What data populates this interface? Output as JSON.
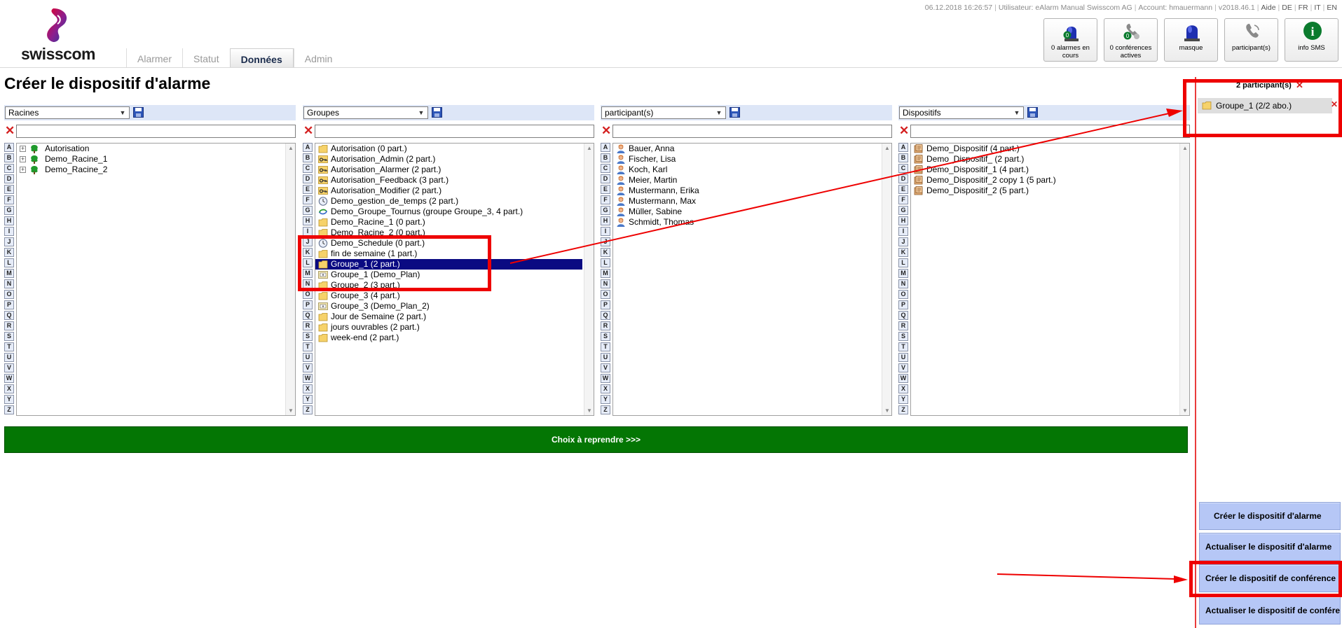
{
  "header": {
    "brand": "swisscom",
    "info": {
      "datetime": "06.12.2018 16:26:57",
      "user": "Utilisateur: eAlarm Manual Swisscom AG",
      "account": "Account: hmauermann",
      "version": "v2018.46.1",
      "help": "Aide",
      "languages": [
        "DE",
        "FR",
        "IT",
        "EN"
      ]
    },
    "tabs": [
      "Alarmer",
      "Statut",
      "Données",
      "Admin"
    ],
    "active_tab": "Données",
    "status_buttons": [
      {
        "label": "0 alarmes en cours",
        "icon": "alarm-light-icon",
        "badge": "0"
      },
      {
        "label": "0 conférences actives",
        "icon": "conference-phone-icon",
        "badge": "0"
      },
      {
        "label": "masque",
        "icon": "blue-light-icon"
      },
      {
        "label": "participant(s)",
        "icon": "phone-icon"
      },
      {
        "label": "info SMS",
        "icon": "info-icon",
        "badge": "i"
      }
    ]
  },
  "page": {
    "title": "Créer le dispositif d'alarme"
  },
  "columns": [
    {
      "select_value": "Racines",
      "filter_value": "",
      "items": [
        {
          "label": "Autorisation",
          "icon": "tree-icon",
          "expandable": true
        },
        {
          "label": "Demo_Racine_1",
          "icon": "tree-icon",
          "expandable": true
        },
        {
          "label": "Demo_Racine_2",
          "icon": "tree-icon",
          "expandable": true
        }
      ]
    },
    {
      "select_value": "Groupes",
      "filter_value": "",
      "items": [
        {
          "label": "Autorisation (0 part.)",
          "icon": "folder-icon"
        },
        {
          "label": "Autorisation_Admin (2 part.)",
          "icon": "key-icon"
        },
        {
          "label": "Autorisation_Alarmer (2 part.)",
          "icon": "key-icon"
        },
        {
          "label": "Autorisation_Feedback (3 part.)",
          "icon": "key-icon"
        },
        {
          "label": "Autorisation_Modifier (2 part.)",
          "icon": "key-icon"
        },
        {
          "label": "Demo_gestion_de_temps (2 part.)",
          "icon": "clock-icon"
        },
        {
          "label": "Demo_Groupe_Tournus (groupe Groupe_3, 4 part.)",
          "icon": "rotation-icon"
        },
        {
          "label": "Demo_Racine_1 (0 part.)",
          "icon": "folder-icon"
        },
        {
          "label": "Demo_Racine_2 (0 part.)",
          "icon": "folder-icon"
        },
        {
          "label": "Demo_Schedule (0 part.)",
          "icon": "clock-icon"
        },
        {
          "label": "fin de semaine (1 part.)",
          "icon": "folder-icon"
        },
        {
          "label": "Groupe_1 (2 part.)",
          "icon": "folder-icon",
          "selected": true
        },
        {
          "label": "Groupe_1 (Demo_Plan)",
          "icon": "plan-icon"
        },
        {
          "label": "Groupe_2 (3 part.)",
          "icon": "folder-icon"
        },
        {
          "label": "Groupe_3 (4 part.)",
          "icon": "folder-icon"
        },
        {
          "label": "Groupe_3 (Demo_Plan_2)",
          "icon": "plan-icon"
        },
        {
          "label": "Jour de Semaine (2 part.)",
          "icon": "folder-icon"
        },
        {
          "label": "jours ouvrables (2 part.)",
          "icon": "folder-icon"
        },
        {
          "label": "week-end (2 part.)",
          "icon": "folder-icon"
        }
      ]
    },
    {
      "select_value": "participant(s)",
      "filter_value": "",
      "items": [
        {
          "label": "Bauer, Anna",
          "icon": "person-icon"
        },
        {
          "label": "Fischer, Lisa",
          "icon": "person-icon"
        },
        {
          "label": "Koch, Karl",
          "icon": "person-icon"
        },
        {
          "label": "Meier, Martin",
          "icon": "person-icon"
        },
        {
          "label": "Mustermann, Erika",
          "icon": "person-icon"
        },
        {
          "label": "Mustermann, Max",
          "icon": "person-icon"
        },
        {
          "label": "Müller, Sabine",
          "icon": "person-icon"
        },
        {
          "label": "Schmidt, Thomas",
          "icon": "person-icon"
        }
      ]
    },
    {
      "select_value": "Dispositifs",
      "filter_value": "",
      "items": [
        {
          "label": "Demo_Dispositif (4 part.)",
          "icon": "device-icon"
        },
        {
          "label": "Demo_Dispositif_ (2 part.)",
          "icon": "device-icon"
        },
        {
          "label": "Demo_Dispositif_1 (4 part.)",
          "icon": "device-icon"
        },
        {
          "label": "Demo_Dispositif_2 copy 1 (5 part.)",
          "icon": "device-icon"
        },
        {
          "label": "Demo_Dispositif_2 (5 part.)",
          "icon": "device-icon"
        }
      ]
    }
  ],
  "alphabet": [
    "A",
    "B",
    "C",
    "D",
    "E",
    "F",
    "G",
    "H",
    "I",
    "J",
    "K",
    "L",
    "M",
    "N",
    "O",
    "P",
    "Q",
    "R",
    "S",
    "T",
    "U",
    "V",
    "W",
    "X",
    "Y",
    "Z"
  ],
  "choose_button": "Choix à reprendre >>>",
  "right_panel": {
    "title": "2 participant(s)",
    "items": [
      {
        "label": "Groupe_1 (2/2 abo.)",
        "icon": "folder-icon"
      }
    ],
    "actions": [
      "Créer le dispositif d'alarme",
      "Actualiser le dispositif d'alarme",
      "Créer le dispositif de conférence",
      "Actualiser le dispositif de conférence"
    ]
  },
  "colors": {
    "header_band": "#dde6f7",
    "selection": "#0a0a82",
    "green_button": "#047604",
    "action_button": "#b6c7f6",
    "annotation_red": "#ee0000"
  }
}
